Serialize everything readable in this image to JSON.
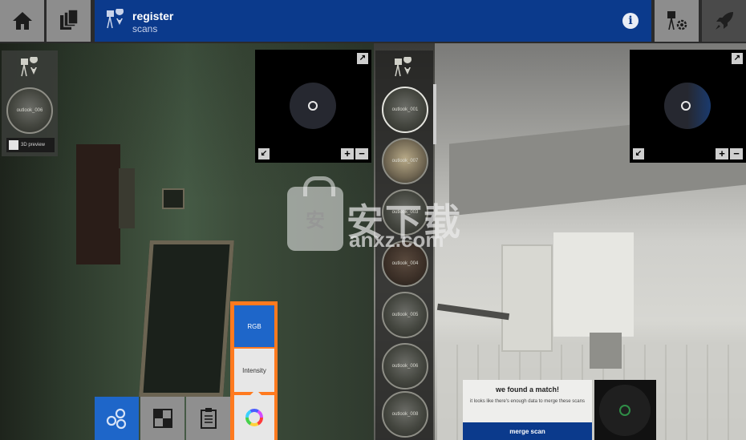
{
  "header": {
    "title": "register",
    "subtitle": "scans"
  },
  "left_panel": {
    "thumbnail_label": "outlook_006",
    "preview_3d_label": "3D preview"
  },
  "scan_list": {
    "items": [
      "outlook_001",
      "outlook_007",
      "outlook_003",
      "outlook_004",
      "outlook_005",
      "outlook_006",
      "outlook_008"
    ]
  },
  "minimap": {
    "zoom_in": "+",
    "zoom_out": "−"
  },
  "color_modes": {
    "rgb_label": "RGB",
    "intensity_label": "Intensity",
    "selected": "RGB"
  },
  "match": {
    "title": "we found a match!",
    "text": "it looks like there's enough data to merge these scans",
    "button_label": "merge scan"
  },
  "watermark": {
    "chinese": "安下载",
    "url": "anxz.com",
    "badge_char": "安"
  },
  "colors": {
    "accent_blue": "#0b3a8c",
    "active_blue": "#1e66c9",
    "highlight_orange": "#ff7a1f"
  }
}
